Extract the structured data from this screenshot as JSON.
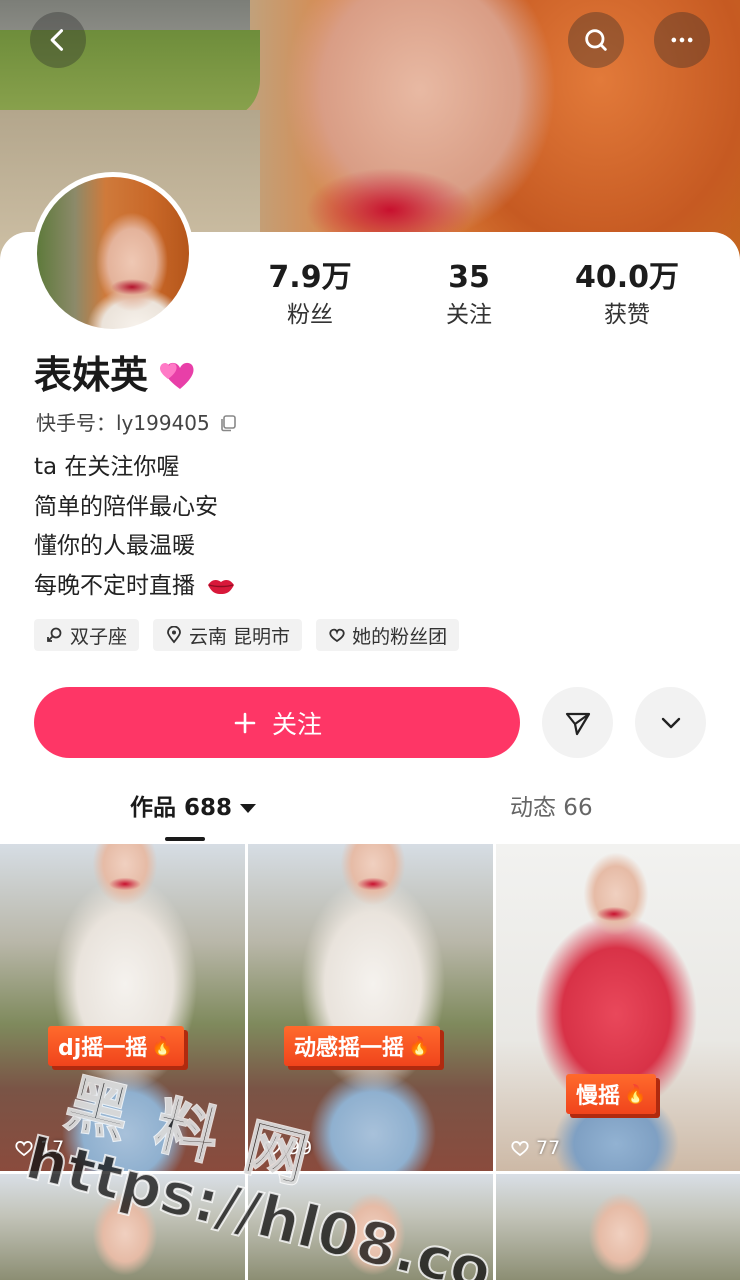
{
  "header": {
    "back_icon": "chevron-left-icon",
    "search_icon": "search-icon",
    "more_icon": "more-horizontal-icon"
  },
  "profile": {
    "name": "表妹英",
    "kuaishou_id": "快手号：ly199405",
    "bio": [
      "ta 在关注你喔",
      "简单的陪伴最心安",
      "懂你的人最温暖",
      "每晚不定时直播"
    ],
    "stats": [
      {
        "value": "7.9万",
        "label": "粉丝"
      },
      {
        "value": "35",
        "label": "关注"
      },
      {
        "value": "40.0万",
        "label": "获赞"
      }
    ],
    "tags": [
      "双子座",
      "云南 昆明市",
      "她的粉丝团"
    ]
  },
  "actions": {
    "follow_label": "关注"
  },
  "tabs": [
    {
      "label": "作品 688"
    },
    {
      "label": "动态 66"
    }
  ],
  "posts": [
    {
      "sticker": "dj摇一摇",
      "likes": "17"
    },
    {
      "sticker": "动感摇一摇",
      "likes": "99"
    },
    {
      "sticker": "慢摇",
      "likes": "77"
    }
  ],
  "watermark": {
    "line1": "黑料网",
    "line2": "https://hl08.co"
  },
  "colors": {
    "accent": "#fe3666",
    "sticker": "#f0441c"
  }
}
